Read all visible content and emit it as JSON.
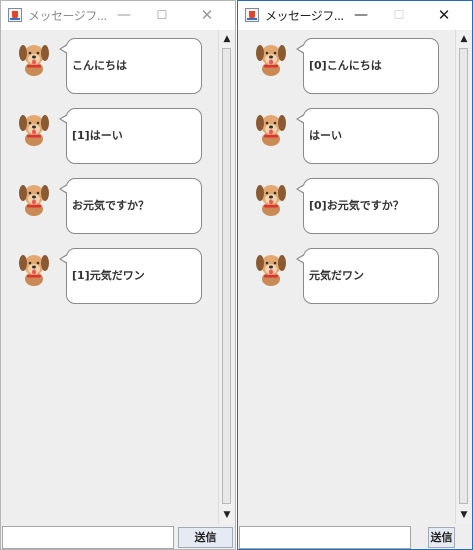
{
  "windows": [
    {
      "title": "メッセージフ...",
      "minimize": "—",
      "maximize": "☐",
      "close": "✕",
      "messages": [
        {
          "text": "こんにちは"
        },
        {
          "text": "[1]はーい"
        },
        {
          "text": "お元気ですか？"
        },
        {
          "text": "[1]元気だワン"
        }
      ],
      "input_value": "",
      "send_label": "送信"
    },
    {
      "title": "メッセージフ...",
      "minimize": "—",
      "maximize": "☐",
      "close": "✕",
      "messages": [
        {
          "text": "[0]こんにちは"
        },
        {
          "text": "はーい"
        },
        {
          "text": "[0]お元気ですか？"
        },
        {
          "text": "元気だワン"
        }
      ],
      "input_value": "",
      "send_label": "送信"
    }
  ],
  "icons": {
    "app": "java-app-icon",
    "avatar": "dog-avatar-icon",
    "scroll_up": "scroll-up-arrow-icon",
    "scroll_down": "scroll-down-arrow-icon"
  },
  "scroll_arrows": {
    "up": "▲",
    "down": "▼"
  }
}
